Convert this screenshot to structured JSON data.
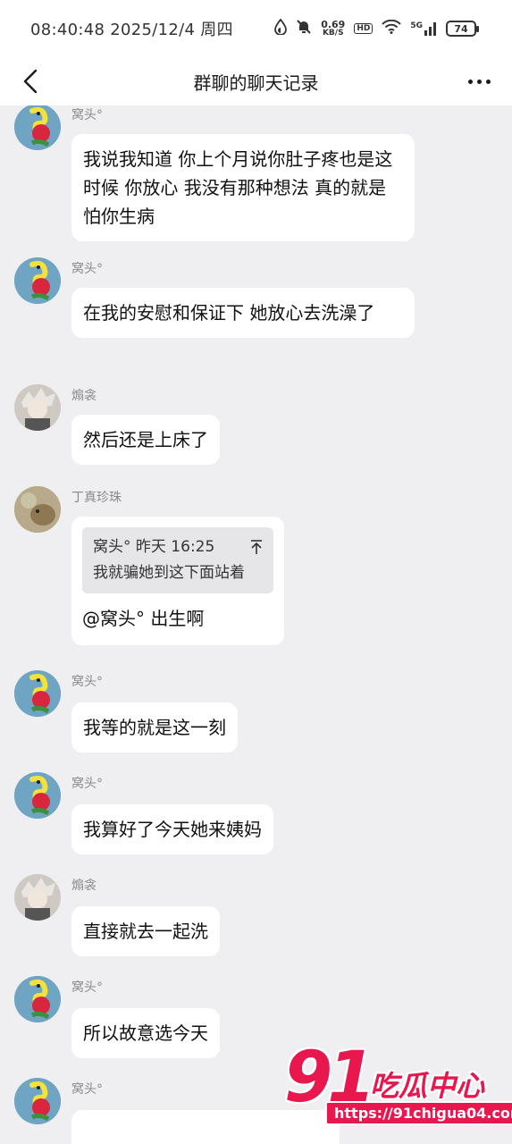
{
  "status_bar": {
    "time": "08:40:48 2025/12/4 周四",
    "net_speed_value": "0.69",
    "net_speed_unit": "KB/S",
    "hd_label": "HD",
    "signal_label": "5G",
    "battery": "74"
  },
  "nav": {
    "title": "群聊的聊天记录"
  },
  "messages": [
    {
      "sender": "窝头°",
      "avatar": "wotou",
      "text": "我说我知道 你上个月说你肚子疼也是这时候 你放心 我没有那种想法 真的就是怕你生病"
    },
    {
      "sender": "窝头°",
      "avatar": "wotou",
      "text": "在我的安慰和保证下 她放心去洗澡了"
    },
    {
      "sender": "煽衾",
      "avatar": "shanzhe",
      "text": "然后还是上床了"
    },
    {
      "sender": "丁真珍珠",
      "avatar": "dingzhen",
      "quote": {
        "author": "窝头° 昨天 16:25",
        "text": "我就骗她到这下面站着"
      },
      "text": "@窝头° 出生啊"
    },
    {
      "sender": "窝头°",
      "avatar": "wotou",
      "text": "我等的就是这一刻"
    },
    {
      "sender": "窝头°",
      "avatar": "wotou",
      "text": "我算好了今天她来姨妈"
    },
    {
      "sender": "煽衾",
      "avatar": "shanzhe",
      "text": "直接就去一起洗"
    },
    {
      "sender": "窝头°",
      "avatar": "wotou",
      "text": "所以故意选今天"
    },
    {
      "sender": "窝头°",
      "avatar": "wotou",
      "text": ""
    }
  ],
  "watermark": {
    "number": "91",
    "brand": "吃瓜中心",
    "url": "https://91chigua04.com"
  },
  "colors": {
    "background": "#efeff2",
    "bubble": "#ffffff",
    "watermark": "#e8174e"
  }
}
